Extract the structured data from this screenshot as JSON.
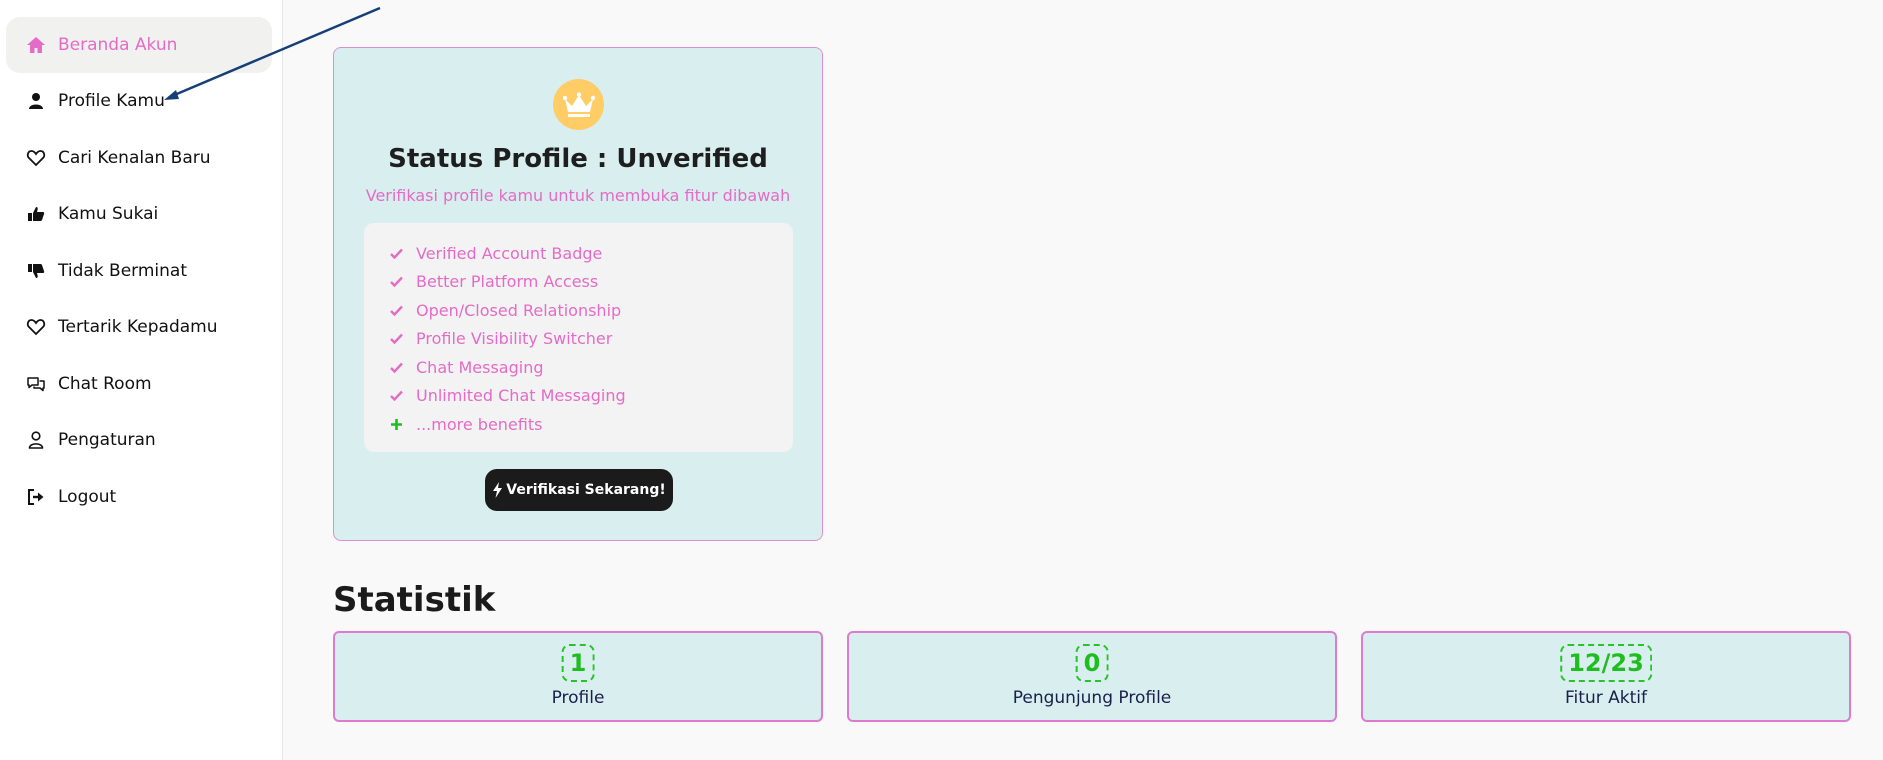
{
  "sidebar": {
    "items": [
      {
        "label": "Beranda Akun",
        "icon": "home-icon",
        "active": true
      },
      {
        "label": "Profile Kamu",
        "icon": "user-icon"
      },
      {
        "label": "Cari Kenalan Baru",
        "icon": "heart-outline-icon"
      },
      {
        "label": "Kamu Sukai",
        "icon": "thumbs-up-icon"
      },
      {
        "label": "Tidak Berminat",
        "icon": "thumbs-down-icon"
      },
      {
        "label": "Tertarik Kepadamu",
        "icon": "heart-outline-icon"
      },
      {
        "label": "Chat Room",
        "icon": "chat-bubbles-icon"
      },
      {
        "label": "Pengaturan",
        "icon": "user-outline-icon"
      },
      {
        "label": "Logout",
        "icon": "logout-icon"
      }
    ]
  },
  "status": {
    "icon": "crown-icon",
    "title": "Status Profile : Unverified",
    "subtitle": "Verifikasi profile kamu untuk membuka fitur dibawah",
    "benefits": [
      "Verified Account Badge",
      "Better Platform Access",
      "Open/Closed Relationship",
      "Profile Visibility Switcher",
      "Chat Messaging",
      "Unlimited Chat Messaging",
      "...more benefits"
    ],
    "button_label": "Verifikasi Sekarang!"
  },
  "stats": {
    "heading": "Statistik",
    "cards": [
      {
        "value": "1",
        "label": "Profile"
      },
      {
        "value": "0",
        "label": "Pengunjung Profile"
      },
      {
        "value": "12/23",
        "label": "Fitur Aktif"
      }
    ]
  },
  "colors": {
    "accent_pink": "#e46bc7",
    "card_bg": "#d9eeee",
    "stat_green": "#1fbe1f",
    "button_dark": "#1b1b1b",
    "crown_bg": "#ffcc66"
  }
}
